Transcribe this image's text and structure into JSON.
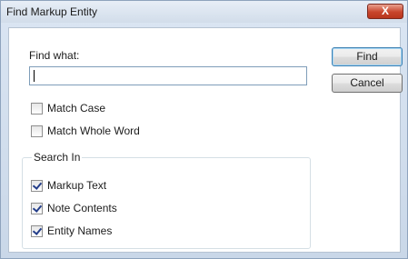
{
  "window": {
    "title": "Find Markup Entity",
    "close_glyph": "X"
  },
  "find": {
    "label": "Find what:",
    "value": "",
    "placeholder": ""
  },
  "buttons": {
    "find_label": "Find",
    "cancel_label": "Cancel"
  },
  "options": {
    "match_case": {
      "label": "Match Case",
      "checked": false
    },
    "match_whole_word": {
      "label": "Match Whole Word",
      "checked": false
    }
  },
  "search_in": {
    "legend": "Search In",
    "items": [
      {
        "label": "Markup Text",
        "checked": true
      },
      {
        "label": "Note Contents",
        "checked": true
      },
      {
        "label": "Entity Names",
        "checked": true
      }
    ]
  },
  "colors": {
    "window_frame": "#c9d7e8",
    "close_button": "#c8452c",
    "checkmark": "#243e8a"
  },
  "icons": {
    "close": "close-icon",
    "check": "checkmark-icon"
  }
}
